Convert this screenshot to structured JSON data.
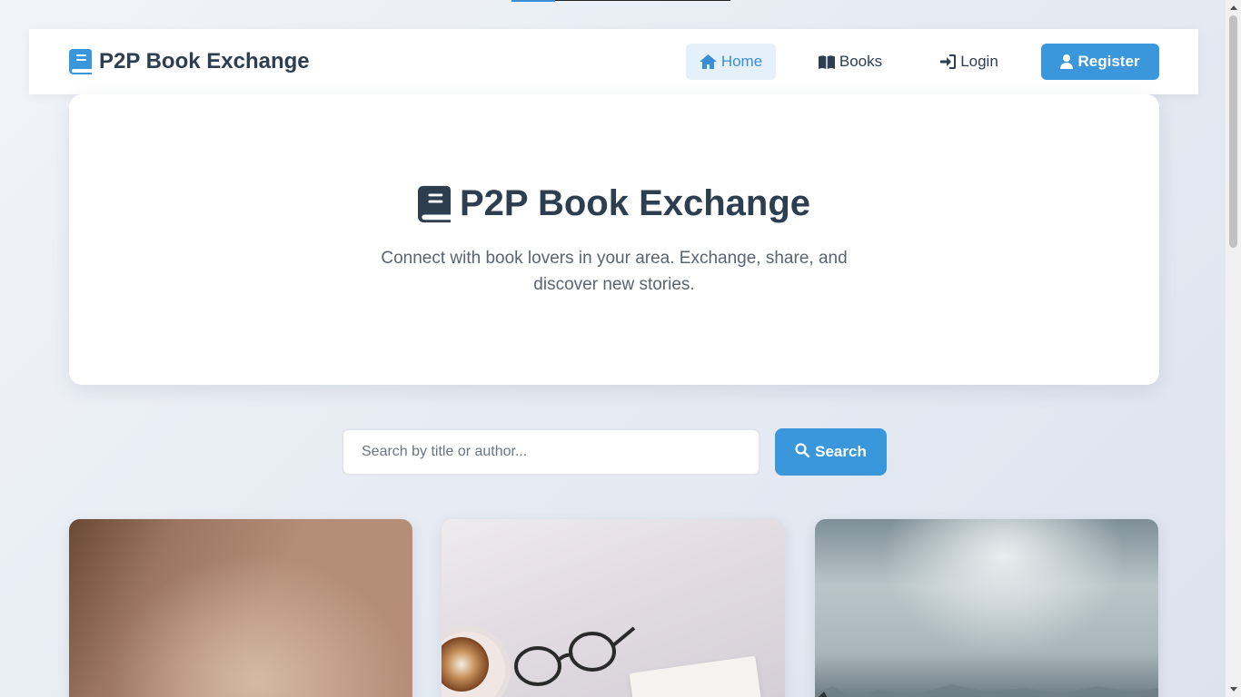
{
  "page": {
    "accent_color": "#3a97db",
    "text_color": "#2c3e50"
  },
  "top_progress": {
    "progress_fraction": 0.2
  },
  "navbar": {
    "brand": "P2P Book Exchange",
    "brand_icon": "book-icon",
    "items": [
      {
        "label": "Home",
        "icon": "home-icon",
        "active": true
      },
      {
        "label": "Books",
        "icon": "book-open-icon",
        "active": false
      },
      {
        "label": "Login",
        "icon": "sign-in-icon",
        "active": false
      },
      {
        "label": "Register",
        "icon": "user-icon",
        "active": false
      }
    ]
  },
  "hero": {
    "title": "P2P Book Exchange",
    "title_icon": "book-icon",
    "subtitle": "Connect with book lovers in your area. Exchange, share, and discover new stories."
  },
  "search": {
    "placeholder": "Search by title or author...",
    "value": "",
    "button_label": "Search",
    "button_icon": "search-icon"
  },
  "cards": [
    {
      "image": "brown-gradient-cover-image"
    },
    {
      "image": "coffee-glasses-book-image"
    },
    {
      "image": "misty-mountain-image"
    }
  ]
}
